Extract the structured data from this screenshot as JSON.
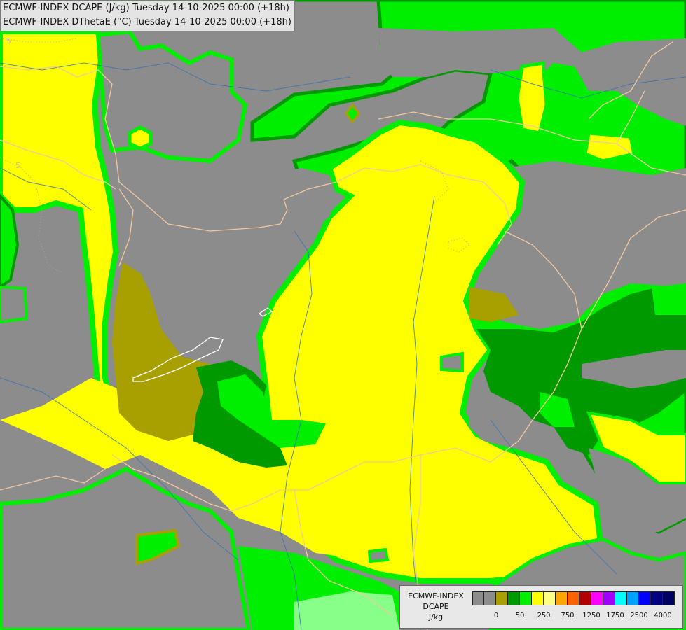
{
  "header": {
    "line1": "ECMWF-INDEX DCAPE (J/kg) Tuesday 14-10-2025 00:00 (+18h)",
    "line2": "ECMWF-INDEX DThetaE (°C) Tuesday 14-10-2025 00:00 (+18h)"
  },
  "map": {
    "contour_labels": [
      "5",
      "5"
    ],
    "shading_levels_colors": [
      "#8c8c8c",
      "#a8a000",
      "#009900",
      "#00ee00",
      "#ffff00"
    ],
    "border_color": "#f2c8a0",
    "river_color": "#3a6fb0"
  },
  "legend": {
    "line1": "ECMWF-INDEX",
    "line2": "DCAPE",
    "line3": "J/kg",
    "colors": [
      "#8c8c8c",
      "#8c8c8c",
      "#a8a000",
      "#009900",
      "#00ee00",
      "#ffff00",
      "#ffff88",
      "#ffa500",
      "#ff6000",
      "#b00000",
      "#ff00ff",
      "#a000ff",
      "#00ffff",
      "#00a0ff",
      "#0000ff",
      "#000080",
      "#000060"
    ],
    "ticks": [
      "0",
      "50",
      "250",
      "750",
      "1250",
      "1750",
      "2500",
      "4000"
    ]
  }
}
